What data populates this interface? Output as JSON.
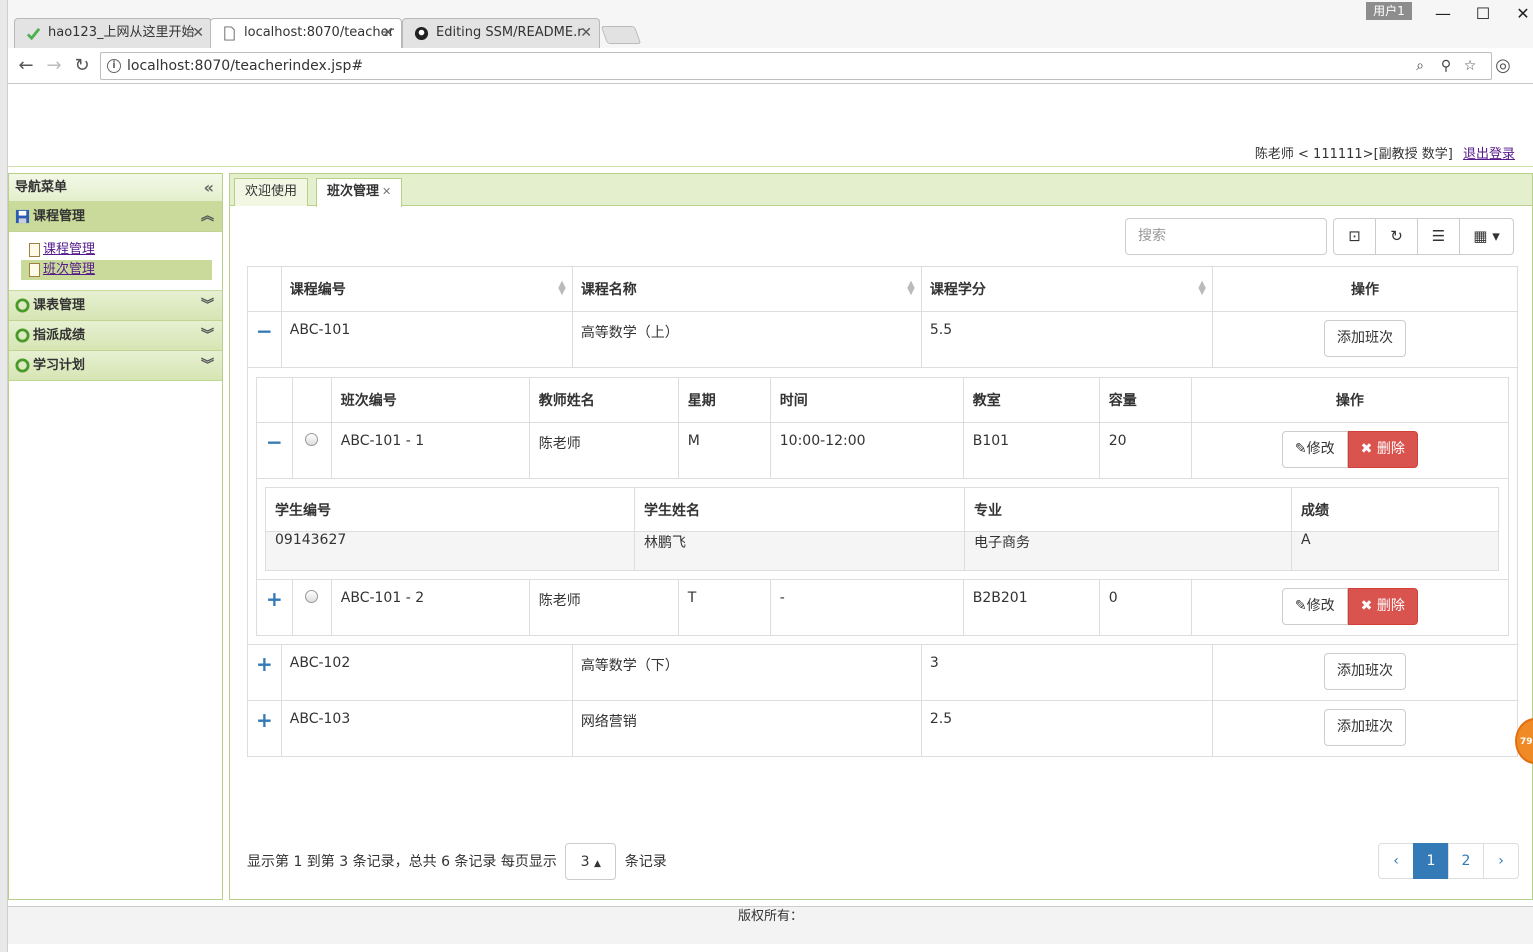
{
  "browser": {
    "tabs": [
      {
        "title": "hao123_上网从这里开始"
      },
      {
        "title": "localhost:8070/teacher"
      },
      {
        "title": "Editing SSM/README.r"
      }
    ],
    "user_chip": "用户1",
    "url": "localhost:8070/teacherindex.jsp#"
  },
  "header": {
    "user_info": "陈老师 < 111111>[副教授 数学]",
    "logout": "退出登录"
  },
  "sidebar": {
    "title": "导航菜单",
    "groups": [
      {
        "label": "课程管理",
        "items": [
          {
            "label": "课程管理"
          },
          {
            "label": "班次管理"
          }
        ]
      },
      {
        "label": "课表管理"
      },
      {
        "label": "指派成绩"
      },
      {
        "label": "学习计划"
      }
    ]
  },
  "main": {
    "tabs": [
      {
        "label": "欢迎使用"
      },
      {
        "label": "班次管理"
      }
    ],
    "search_placeholder": "搜索",
    "course_columns": [
      "课程编号",
      "课程名称",
      "课程学分",
      "操作"
    ],
    "add_class_label": "添加班次",
    "courses": [
      {
        "id": "ABC-101",
        "name": "高等数学（上）",
        "credit": "5.5",
        "expanded": "−"
      },
      {
        "id": "ABC-102",
        "name": "高等数学（下）",
        "credit": "3",
        "expanded": "+"
      },
      {
        "id": "ABC-103",
        "name": "网络营销",
        "credit": "2.5",
        "expanded": "+"
      }
    ],
    "class_columns": [
      "班次编号",
      "教师姓名",
      "星期",
      "时间",
      "教室",
      "容量",
      "操作"
    ],
    "edit_label": "修改",
    "delete_label": "删除",
    "classes": [
      {
        "id": "ABC-101 - 1",
        "teacher": "陈老师",
        "day": "M",
        "time": "10:00-12:00",
        "room": "B101",
        "capacity": "20",
        "expanded": "−"
      },
      {
        "id": "ABC-101 - 2",
        "teacher": "陈老师",
        "day": "T",
        "time": "-",
        "room": "B2B201",
        "capacity": "0",
        "expanded": "+"
      }
    ],
    "student_columns": [
      "学生编号",
      "学生姓名",
      "专业",
      "成绩"
    ],
    "students": [
      {
        "id": "09143627",
        "name": "林鹏飞",
        "major": "电子商务",
        "grade": "A"
      }
    ],
    "footer_pre": "显示第 1 到第 3 条记录，总共 6 条记录 每页显示",
    "page_size": "3",
    "footer_post": "条记录",
    "pager": {
      "prev": "‹",
      "pages": [
        "1",
        "2"
      ],
      "next": "›",
      "active_page": "1"
    }
  },
  "copyright": "版权所有：",
  "badge": "79"
}
